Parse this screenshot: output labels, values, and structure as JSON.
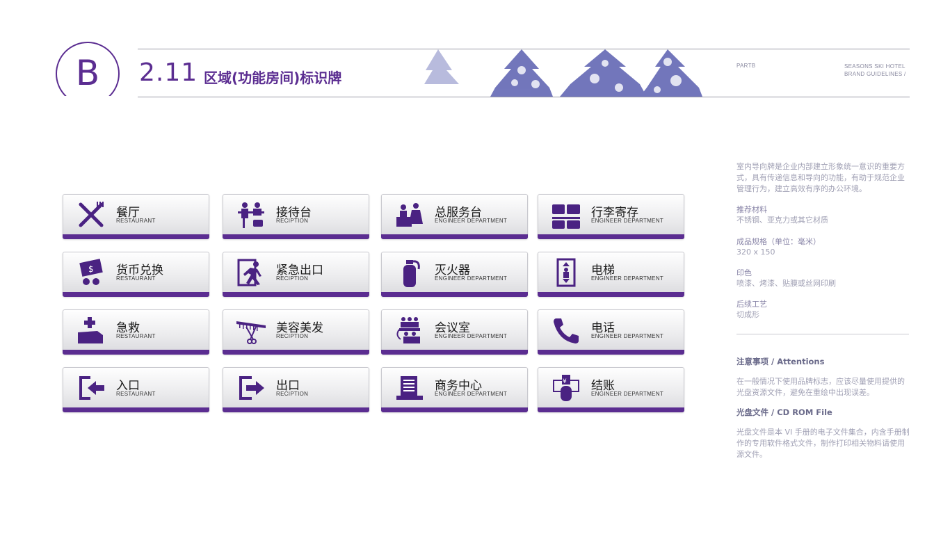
{
  "header": {
    "badge_letter": "B",
    "section_number": "2.11",
    "section_title": "区域(功能房间)标识牌",
    "part_label": "PARTB",
    "brand_line1": "SEASONS SKI HOTEL",
    "brand_line2": "BRAND GUIDELINES /"
  },
  "colors": {
    "accent": "#5b2d91",
    "sign_bg": "#e6e6ea"
  },
  "signs": [
    {
      "zh": "餐厅",
      "en": "RESTAURANT",
      "icon": "utensils-icon"
    },
    {
      "zh": "接待台",
      "en": "RECIPTION",
      "icon": "reception-icon"
    },
    {
      "zh": "总服务台",
      "en": "ENGINEER DEPARTMENT",
      "icon": "service-desk-icon"
    },
    {
      "zh": "行李寄存",
      "en": "ENGINEER DEPARTMENT",
      "icon": "luggage-icon"
    },
    {
      "zh": "货币兑换",
      "en": "RESTAURANT",
      "icon": "currency-exchange-icon"
    },
    {
      "zh": "紧急出口",
      "en": "RECIPTION",
      "icon": "emergency-exit-icon"
    },
    {
      "zh": "灭火器",
      "en": "ENGINEER DEPARTMENT",
      "icon": "fire-extinguisher-icon"
    },
    {
      "zh": "电梯",
      "en": "ENGINEER DEPARTMENT",
      "icon": "elevator-icon"
    },
    {
      "zh": "急救",
      "en": "RESTAURANT",
      "icon": "first-aid-icon"
    },
    {
      "zh": "美容美发",
      "en": "RECIPTION",
      "icon": "salon-icon"
    },
    {
      "zh": "会议室",
      "en": "ENGINEER DEPARTMENT",
      "icon": "meeting-room-icon"
    },
    {
      "zh": "电话",
      "en": "ENGINEER DEPARTMENT",
      "icon": "phone-icon"
    },
    {
      "zh": "入口",
      "en": "RESTAURANT",
      "icon": "entrance-icon"
    },
    {
      "zh": "出口",
      "en": "RECIPTION",
      "icon": "exit-icon"
    },
    {
      "zh": "商务中心",
      "en": "ENGINEER DEPARTMENT",
      "icon": "business-center-icon"
    },
    {
      "zh": "结账",
      "en": "ENGINEER DEPARTMENT",
      "icon": "checkout-icon"
    }
  ],
  "sidebar": {
    "intro": "室内导向牌是企业内部建立形象统一意识的重要方式，具有传递信息和导向的功能，有助于规范企业管理行为，建立高效有序的办公环境。",
    "material_label": "推荐材料",
    "material_value": "不锈钢、亚克力或其它材质",
    "size_label": "成品规格（单位：毫米）",
    "size_value": "320 x 150",
    "print_label": "印色",
    "print_value": "喷漆、烤漆、贴膜或丝网印刷",
    "post_label": "后续工艺",
    "post_value": "切成形",
    "attention_title": "注意事项 / Attentions",
    "attention_text": "在一般情况下使用品牌标志，应该尽量使用提供的光盘资源文件，避免在重绘中出现误差。",
    "cdrom_title": "光盘文件 / CD ROM File",
    "cdrom_text": "光盘文件是本 VI 手册的电子文件集合，内含手册制作的专用软件格式文件，制作打印相关物料请使用源文件。"
  }
}
